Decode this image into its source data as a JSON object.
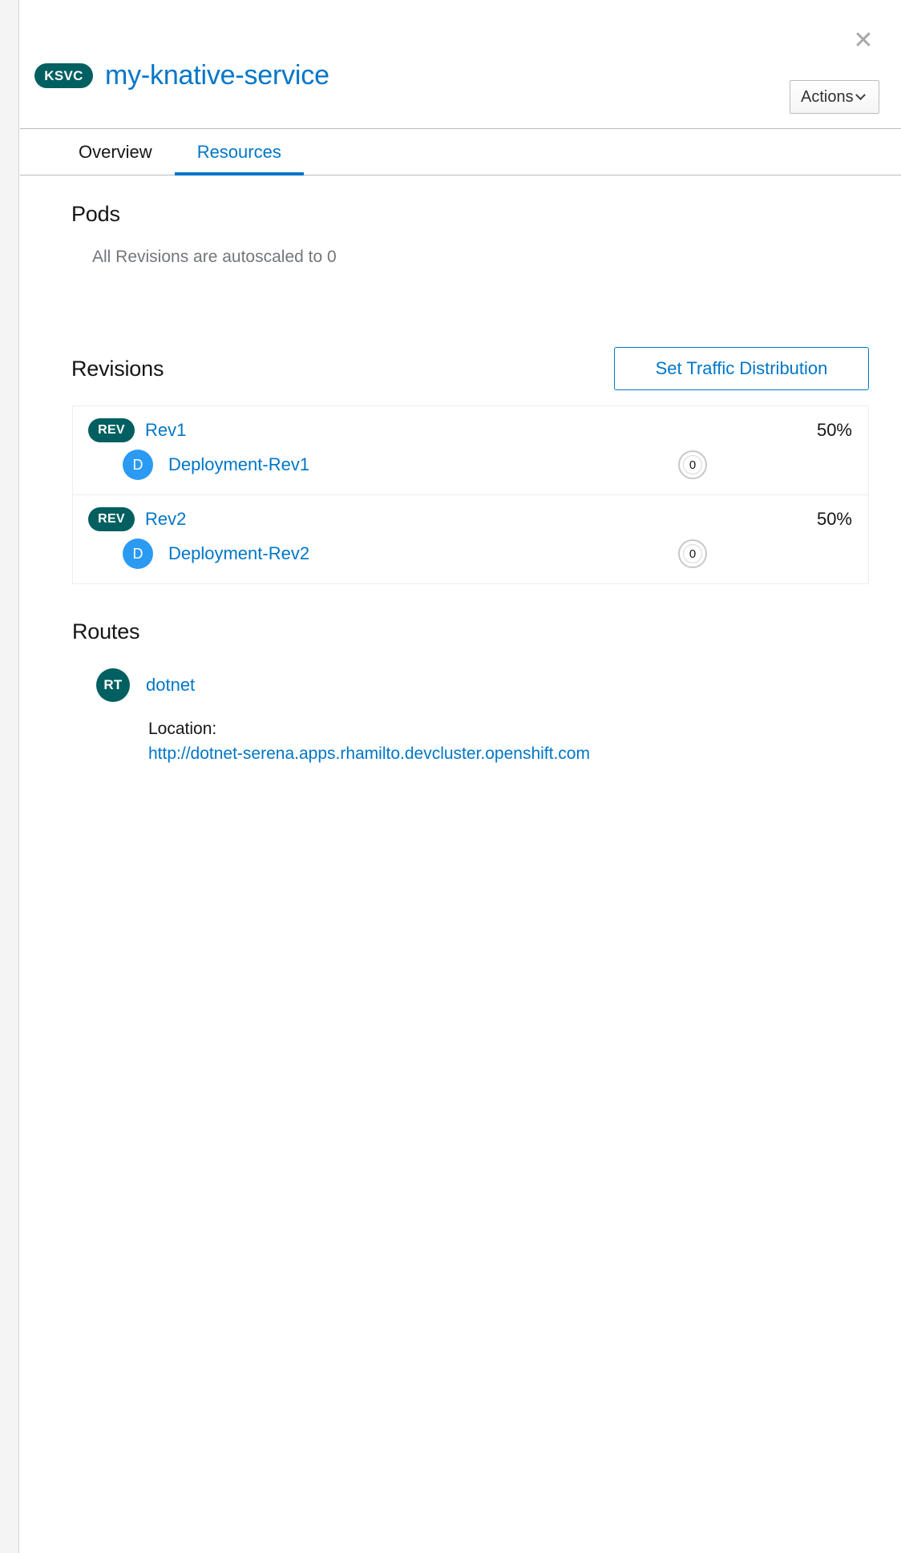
{
  "header": {
    "badge": "KSVC",
    "title": "my-knative-service",
    "close_label": "✕",
    "actions_label": "Actions"
  },
  "tabs": [
    {
      "label": "Overview",
      "active": false
    },
    {
      "label": "Resources",
      "active": true
    }
  ],
  "pods": {
    "heading": "Pods",
    "message": "All Revisions are autoscaled to 0"
  },
  "revisions": {
    "heading": "Revisions",
    "traffic_button": "Set Traffic Distribution",
    "items": [
      {
        "badge": "REV",
        "name": "Rev1",
        "percent": "50%",
        "deployment": {
          "badge": "D",
          "name": "Deployment-Rev1",
          "pod_count": "0"
        }
      },
      {
        "badge": "REV",
        "name": "Rev2",
        "percent": "50%",
        "deployment": {
          "badge": "D",
          "name": "Deployment-Rev2",
          "pod_count": "0"
        }
      }
    ]
  },
  "routes": {
    "heading": "Routes",
    "badge": "RT",
    "name": "dotnet",
    "location_label": "Location:",
    "location_url": "http://dotnet-serena.apps.rhamilto.devcluster.openshift.com"
  },
  "colors": {
    "link": "#0076c8",
    "badge_teal": "#005f60",
    "badge_blue": "#2b9af3",
    "muted": "#72767b"
  }
}
